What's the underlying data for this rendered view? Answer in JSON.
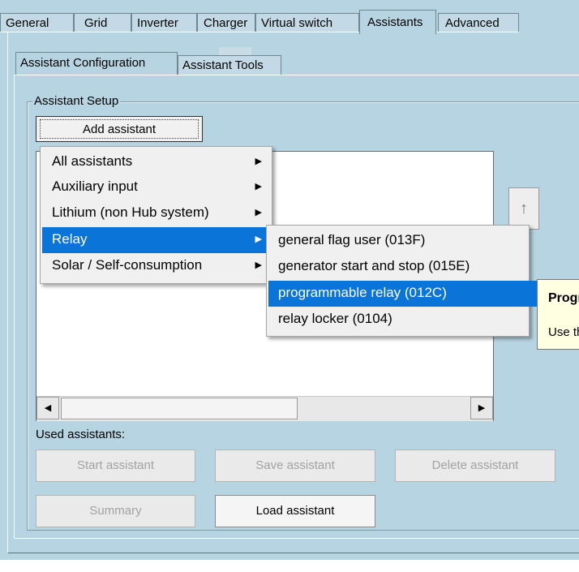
{
  "main_tabs": [
    "General",
    "Grid",
    "Inverter",
    "Charger",
    "Virtual switch",
    "Assistants",
    "Advanced"
  ],
  "active_main_tab": "Assistants",
  "sub_tabs": [
    "Assistant Configuration",
    "Assistant Tools"
  ],
  "active_sub_tab": "Assistant Configuration",
  "assistant_setup": {
    "group_label": "Assistant Setup",
    "add_button": "Add assistant",
    "up_arrow": "↑",
    "scroll_left": "◀",
    "scroll_right": "▶"
  },
  "used_assistants": {
    "label": "Used assistants:",
    "start_button": "Start assistant",
    "save_button": "Save assistant",
    "delete_button": "Delete assistant",
    "summary_button": "Summary",
    "load_button": "Load assistant"
  },
  "add_menu": {
    "items": [
      "All assistants",
      "Auxiliary input",
      "Lithium (non Hub system)",
      "Relay",
      "Solar / Self-consumption"
    ],
    "highlighted": "Relay",
    "submenu_arrow": "▶"
  },
  "relay_submenu": {
    "items": [
      "general flag user (013F)",
      "generator start and stop (015E)",
      "programmable relay (012C)",
      "relay locker (0104)"
    ],
    "highlighted": "programmable relay (012C)"
  },
  "tooltip": {
    "title": "Program",
    "body": "Use this a"
  },
  "colors": {
    "background": "#b7d4e2",
    "highlight": "#0a74d8",
    "tooltip": "#ffffe1"
  }
}
